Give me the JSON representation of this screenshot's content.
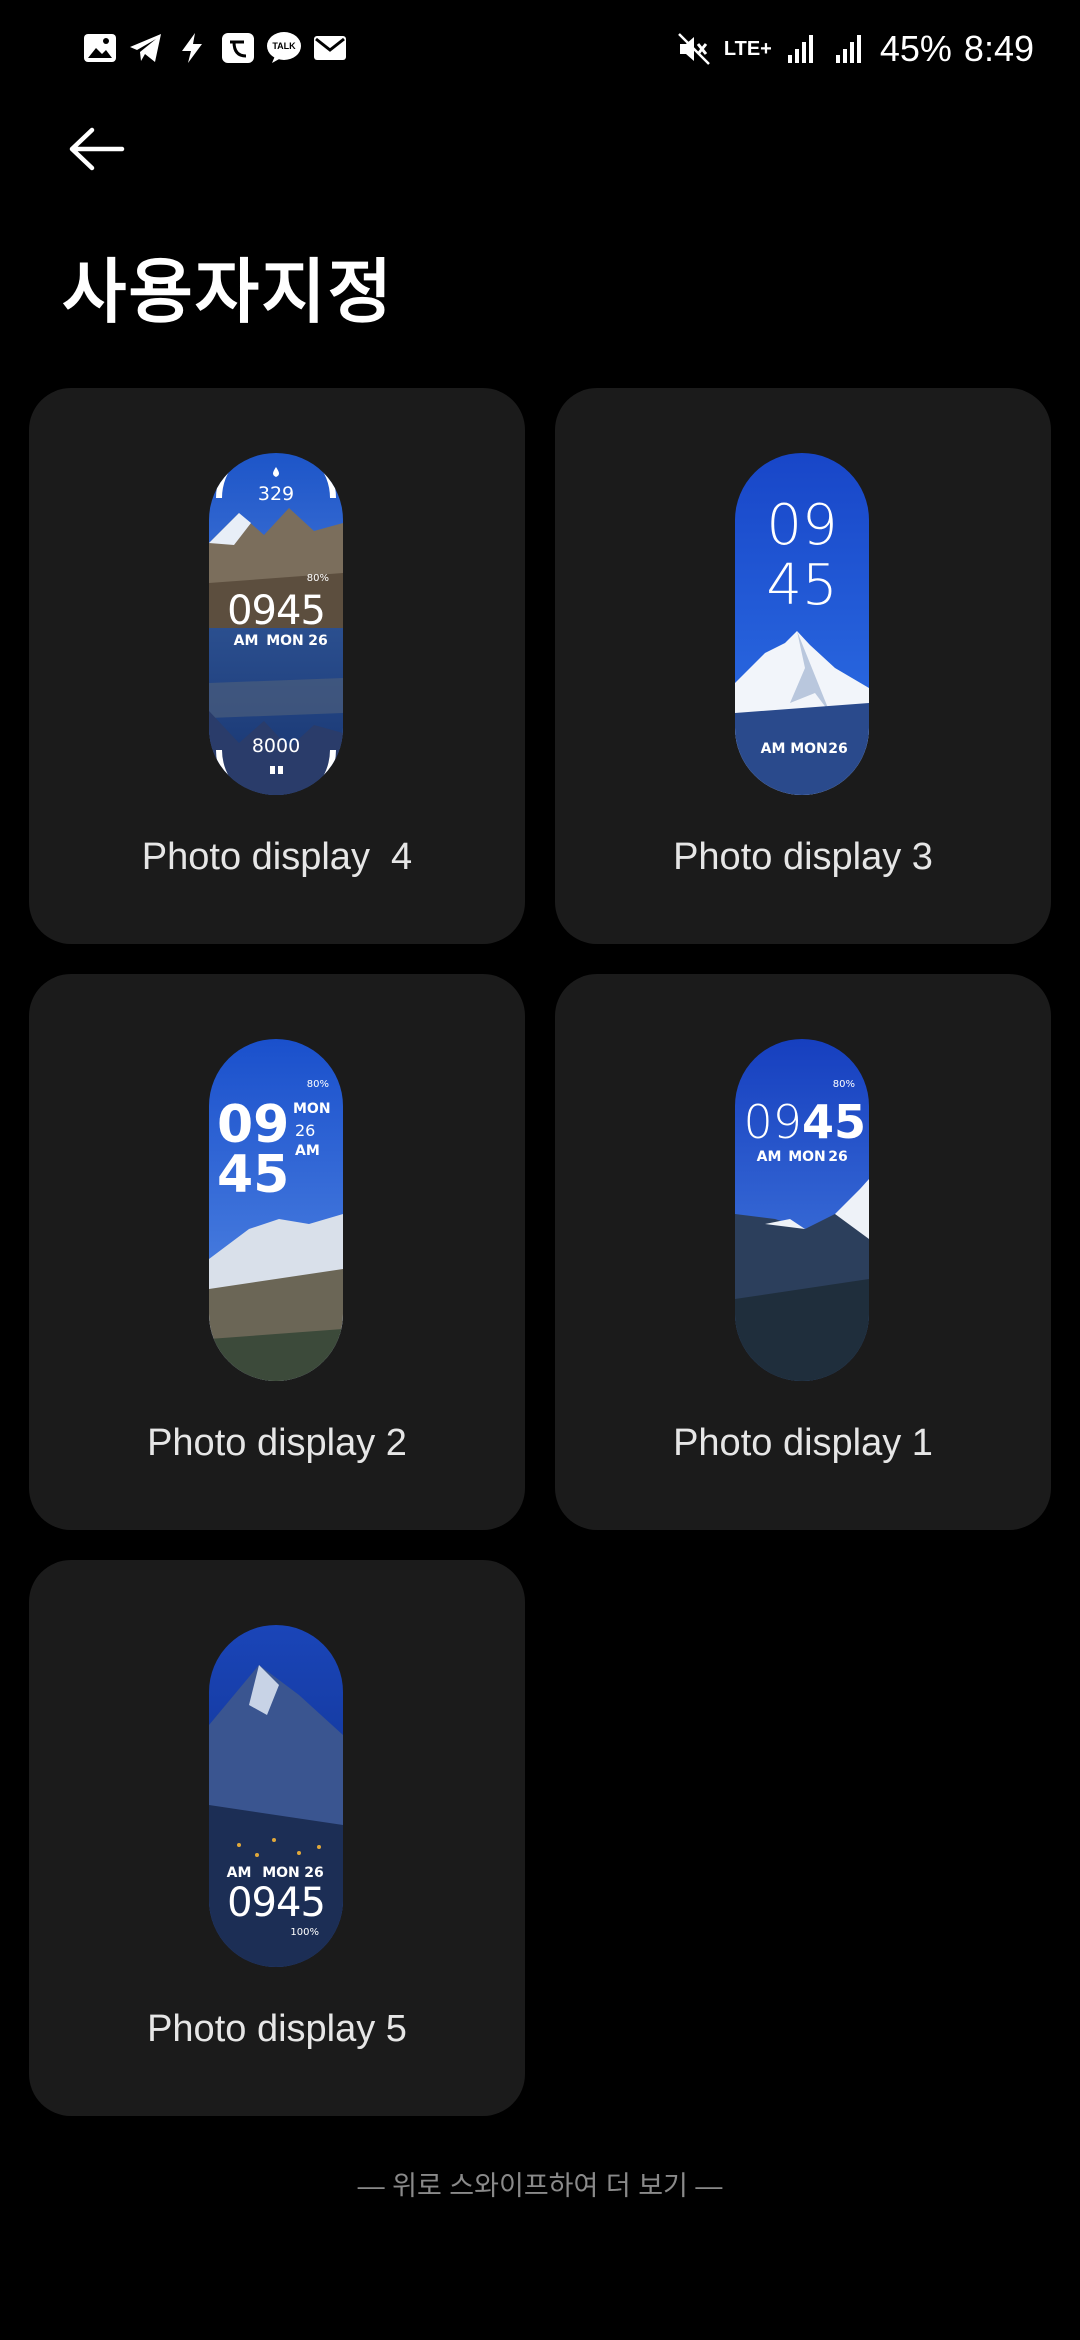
{
  "status_bar": {
    "network": "LTE+",
    "battery": "45%",
    "time": "8:49",
    "left_icons": [
      "gallery-icon",
      "telegram-icon",
      "bolt-icon",
      "app-icon",
      "talk-icon",
      "mail-icon"
    ],
    "talk_badge": "TALK"
  },
  "header": {
    "title": "사용자지정"
  },
  "cards": [
    {
      "label": "Photo display  4",
      "top_value": "329",
      "status": "80%",
      "time": "0945",
      "ampm": "AM",
      "day": "MON",
      "date": "26",
      "bottom_value": "8000"
    },
    {
      "label": "Photo display 3",
      "hour": "09",
      "minute": "45",
      "ampm": "AM",
      "day": "MON",
      "date": "26"
    },
    {
      "label": "Photo display 2",
      "status": "80%",
      "hour": "09",
      "minute": "45",
      "day": "MON",
      "date": "26",
      "ampm": "AM"
    },
    {
      "label": "Photo display 1",
      "status": "80%",
      "hour": "09",
      "minute": "45",
      "ampm": "AM",
      "day": "MON",
      "date": "26"
    },
    {
      "label": "Photo display 5",
      "ampm": "AM",
      "day": "MON",
      "date": "26",
      "time": "0945",
      "status": "100%"
    }
  ],
  "footer": {
    "hint": "—  위로 스와이프하여 더 보기  —"
  },
  "colors": {
    "background": "#000000",
    "card": "#1b1b1b",
    "accent_blue": "#1f5fd6"
  }
}
